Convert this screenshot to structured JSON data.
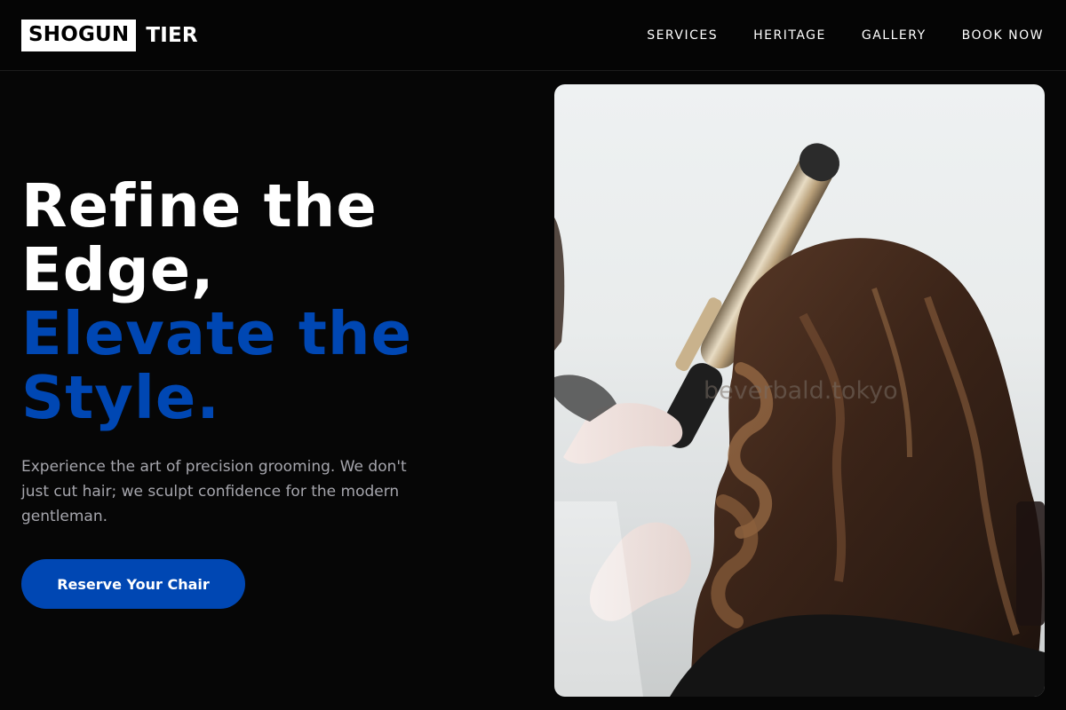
{
  "header": {
    "logo_box": "SHOGUN",
    "logo_rest": "TIER",
    "nav": [
      "SERVICES",
      "HERITAGE",
      "GALLERY",
      "BOOK NOW"
    ]
  },
  "hero": {
    "headline_line1": "Refine the",
    "headline_line2": "Edge,",
    "headline_line3": "Elevate the",
    "headline_line4": "Style.",
    "lead": "Experience the art of precision grooming. We don't just cut hair; we sculpt confidence for the modern gentleman.",
    "cta_label": "Reserve Your Chair"
  },
  "photo": {
    "watermark": "beverbald.tokyo",
    "subject_icon": "hair-styling-photo"
  },
  "colors": {
    "background": "#060606",
    "accent_blue": "#0047b3",
    "text_white": "#ffffff",
    "muted_text": "#a6a6ad"
  }
}
